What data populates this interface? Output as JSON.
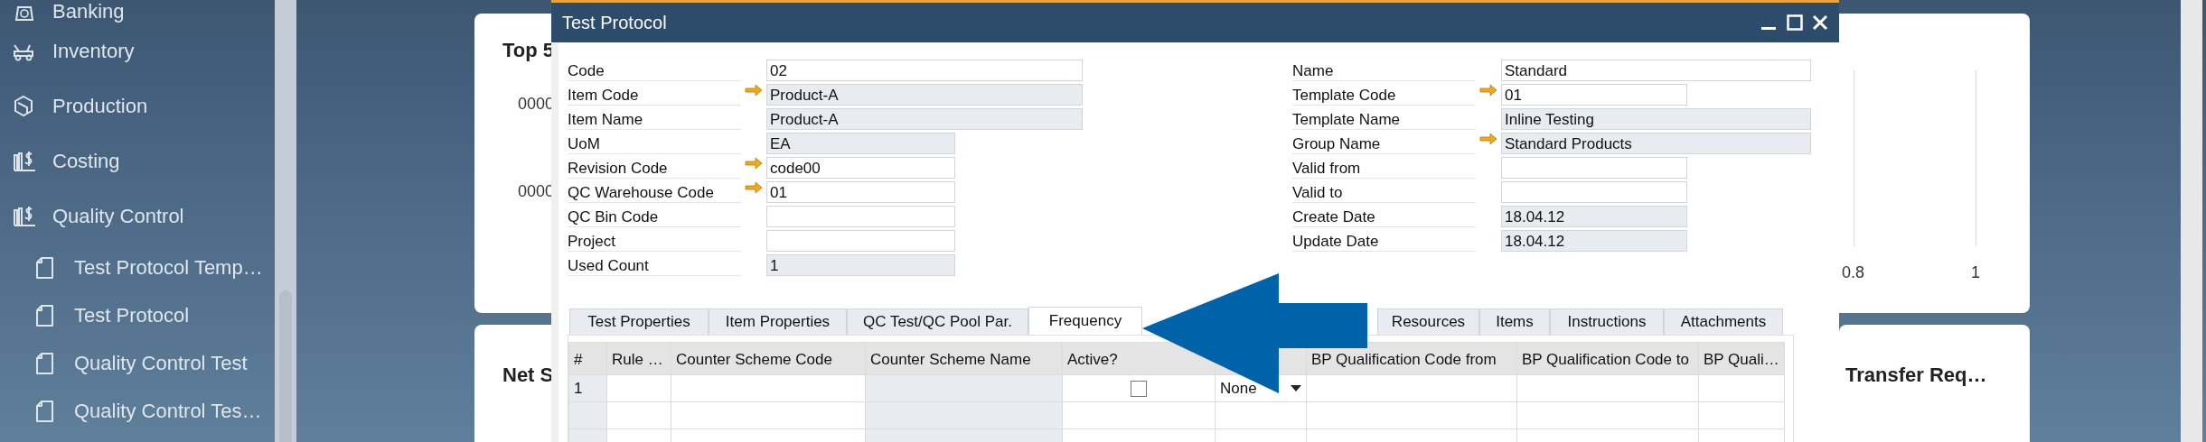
{
  "sidebar": {
    "items": [
      {
        "label": "Banking"
      },
      {
        "label": "Inventory"
      },
      {
        "label": "Production"
      },
      {
        "label": "Costing"
      },
      {
        "label": "Quality Control",
        "children": [
          {
            "label": "Test Protocol Temp…"
          },
          {
            "label": "Test Protocol"
          },
          {
            "label": "Quality Control Test"
          },
          {
            "label": "Quality Control Tes…"
          }
        ]
      }
    ]
  },
  "dashboard": {
    "cards": [
      {
        "title": "Top 5",
        "axis_labels": [
          "0000",
          "0000"
        ],
        "ticks": [
          "0.8",
          "1"
        ]
      },
      {
        "title": "Net S"
      },
      {
        "title": "Transfer Req…"
      }
    ]
  },
  "dialog": {
    "title": "Test Protocol",
    "form_left": [
      {
        "label": "Code",
        "value": "02",
        "link": false,
        "readonly": false
      },
      {
        "label": "Item Code",
        "value": "Product-A",
        "link": true,
        "readonly": true
      },
      {
        "label": "Item Name",
        "value": "Product-A",
        "link": false,
        "readonly": true
      },
      {
        "label": "UoM",
        "value": "EA",
        "link": false,
        "readonly": true
      },
      {
        "label": "Revision Code",
        "value": "code00",
        "link": true,
        "readonly": false
      },
      {
        "label": "QC Warehouse Code",
        "value": "01",
        "link": true,
        "readonly": false
      },
      {
        "label": "QC Bin Code",
        "link": false,
        "readonly": false
      },
      {
        "label": "Project",
        "link": false,
        "readonly": false
      },
      {
        "label": "Used Count",
        "value": "1",
        "link": false,
        "readonly": true
      }
    ],
    "form_right": [
      {
        "label": "Name",
        "value": "Standard",
        "link": false,
        "readonly": false
      },
      {
        "label": "Template Code",
        "value": "01",
        "link": true,
        "readonly": false
      },
      {
        "label": "Template Name",
        "value": "Inline Testing",
        "link": false,
        "readonly": true
      },
      {
        "label": "Group Name",
        "value": "Standard Products",
        "link": true,
        "readonly": true
      },
      {
        "label": "Valid from",
        "link": false,
        "readonly": false
      },
      {
        "label": "Valid to",
        "link": false,
        "readonly": false
      },
      {
        "label": "Create Date",
        "value": "18.04.12",
        "link": false,
        "readonly": true
      },
      {
        "label": "Update Date",
        "value": "18.04.12",
        "link": false,
        "readonly": true
      }
    ],
    "tabs": [
      {
        "label": "Test Properties",
        "selected": false
      },
      {
        "label": "Item Properties",
        "selected": false
      },
      {
        "label": "QC Test/QC Pool Par.",
        "selected": false
      },
      {
        "label": "Frequency",
        "selected": true
      },
      {
        "label": "Resources",
        "selected": false
      },
      {
        "label": "Items",
        "selected": false
      },
      {
        "label": "Instructions",
        "selected": false
      },
      {
        "label": "Attachments",
        "selected": false
      }
    ],
    "grid": {
      "columns": [
        "#",
        "Rule …",
        "Counter Scheme Code",
        "Counter Scheme Name",
        "Active?",
        "BP Qualification Code from",
        "BP Qualification Code to",
        "BP Quali…"
      ],
      "rows": [
        {
          "number": "1",
          "active": false,
          "column_6": "None"
        }
      ]
    }
  }
}
